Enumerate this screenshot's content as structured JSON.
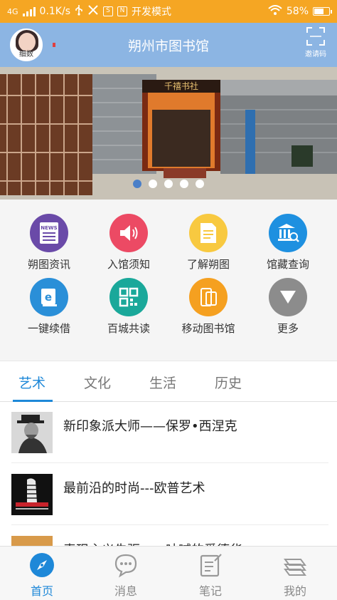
{
  "status_bar": {
    "network": "4G",
    "speed": "0.1K/s",
    "mode": "开发模式",
    "battery": "58%",
    "battery_level": 0.58
  },
  "header": {
    "title": "朔州市图书馆",
    "avatar_caption": "细数",
    "invite_label": "邀请码"
  },
  "banner": {
    "sign_text": "千禧书社",
    "slide_count": 5,
    "active_slide": 0
  },
  "quick_links": [
    {
      "label": "朔图资讯",
      "icon": "news-icon",
      "color": "#6a4aa8",
      "badge": "NEWS"
    },
    {
      "label": "入馆须知",
      "icon": "speaker-icon",
      "color": "#ec4a64"
    },
    {
      "label": "了解朔图",
      "icon": "document-icon",
      "color": "#f8c940"
    },
    {
      "label": "馆藏查询",
      "icon": "library-search-icon",
      "color": "#1e90e0"
    },
    {
      "label": "一键续借",
      "icon": "ebook-icon",
      "color": "#2a8fd8"
    },
    {
      "label": "百城共读",
      "icon": "qr-code-icon",
      "color": "#1aa89a"
    },
    {
      "label": "移动图书馆",
      "icon": "mobile-icon",
      "color": "#f5a020"
    },
    {
      "label": "更多",
      "icon": "more-icon",
      "color": "#8c8c8c"
    }
  ],
  "tabs": {
    "items": [
      "艺术",
      "文化",
      "生活",
      "历史"
    ],
    "active": 0
  },
  "articles": [
    {
      "title": "新印象派大师——保罗•西涅克"
    },
    {
      "title": "最前沿的时尚---欧普艺术"
    },
    {
      "title": "表现主义先驱——呐喊的爱德华"
    }
  ],
  "bottom_nav": [
    {
      "label": "首页",
      "icon": "compass-icon",
      "active": true
    },
    {
      "label": "消息",
      "icon": "chat-bubble-icon",
      "active": false
    },
    {
      "label": "笔记",
      "icon": "notepad-icon",
      "active": false
    },
    {
      "label": "我的",
      "icon": "layers-icon",
      "active": false
    }
  ],
  "colors": {
    "status_bar": "#f5a623",
    "header": "#8cb5e3",
    "accent": "#1e88d8"
  }
}
